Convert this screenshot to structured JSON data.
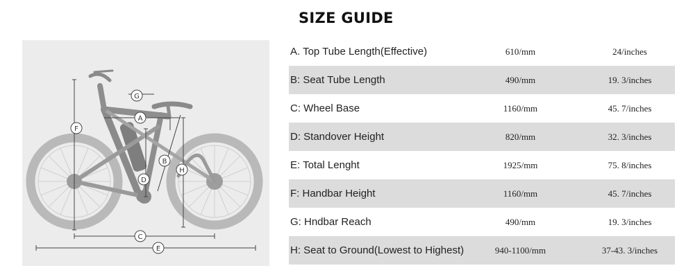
{
  "title": "SIZE GUIDE",
  "rows": [
    {
      "label": "A. Top Tube Length(Effective)",
      "mm": "610/mm",
      "inch": "24/inches"
    },
    {
      "label": "B: Seat Tube Length",
      "mm": "490/mm",
      "inch": "19. 3/inches"
    },
    {
      "label": "C: Wheel Base",
      "mm": "1160/mm",
      "inch": "45. 7/inches"
    },
    {
      "label": "D: Standover Height",
      "mm": "820/mm",
      "inch": "32. 3/inches"
    },
    {
      "label": "E: Total Lenght",
      "mm": "1925/mm",
      "inch": "75. 8/inches"
    },
    {
      "label": "F: Handbar Height",
      "mm": "1160/mm",
      "inch": "45. 7/inches"
    },
    {
      "label": "G: Hndbar Reach",
      "mm": "490/mm",
      "inch": "19. 3/inches"
    },
    {
      "label": "H: Seat to Ground(Lowest to Highest)",
      "mm": "940-1100/mm",
      "inch": "37-43. 3/inches"
    }
  ],
  "diagram": {
    "markers": [
      "A",
      "B",
      "C",
      "D",
      "E",
      "F",
      "G",
      "H"
    ]
  },
  "colors": {
    "shaded_row": "#dcdcdc",
    "diagram_bg": "#ececec"
  }
}
